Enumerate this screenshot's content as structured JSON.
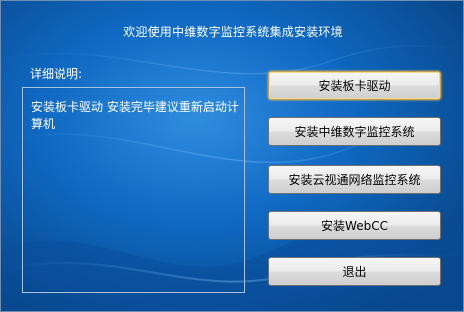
{
  "window": {
    "title": "欢迎使用中维数字监控系统集成安装环境"
  },
  "details": {
    "label": "详细说明:",
    "text": "安装板卡驱动  安装完毕建议重新启动计算机"
  },
  "buttons": {
    "install_card_driver": "安装板卡驱动",
    "install_zhongwei": "安装中维数字监控系统",
    "install_yunshitong": "安装云视通网络监控系统",
    "install_webcc": "安装WebCC",
    "exit": "退出"
  },
  "colors": {
    "background": "#0d66c0",
    "text": "#ffffff",
    "default_button_border": "#c6a04a"
  }
}
